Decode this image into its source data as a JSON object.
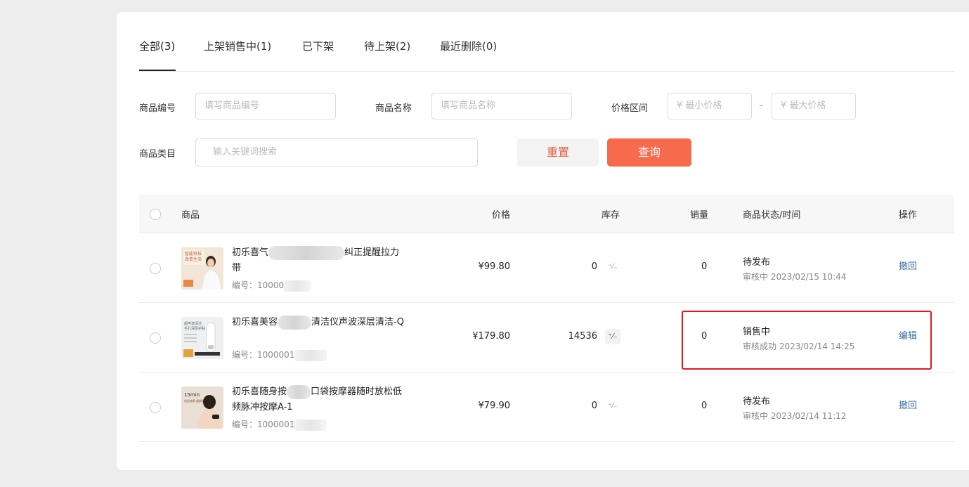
{
  "tabs": [
    {
      "label": "全部(3)"
    },
    {
      "label": "上架销售中(1)"
    },
    {
      "label": "已下架"
    },
    {
      "label": "待上架(2)"
    },
    {
      "label": "最近删除(0)"
    }
  ],
  "filters": {
    "code_label": "商品编号",
    "code_placeholder": "填写商品编号",
    "name_label": "商品名称",
    "name_placeholder": "填写商品名称",
    "price_label": "价格区间",
    "min_placeholder": "¥  最小价格",
    "max_placeholder": "¥  最大价格",
    "dash": "–",
    "category_label": "商品类目",
    "category_placeholder": "输入关键词搜索",
    "reset_label": "重置",
    "query_label": "查询"
  },
  "table": {
    "headers": {
      "product": "商品",
      "price": "价格",
      "stock": "库存",
      "sales": "销量",
      "status": "商品状态/时间",
      "action": "操作"
    },
    "stock_edit_icon": "⁺⁄₋",
    "rows": [
      {
        "name_a": "初乐喜气",
        "name_b": "纠正提醒拉力带",
        "code_prefix": "编号：10000",
        "price": "¥99.80",
        "stock": "0",
        "sales": "0",
        "status": "待发布",
        "status_sub": "审核中 2023/02/15 10:44",
        "action": "撤回"
      },
      {
        "name_a": "初乐喜美容",
        "name_b": "清洁仪声波深层清洁-Q",
        "code_prefix": "编号：1000001",
        "price": "¥179.80",
        "stock": "14536",
        "sales": "0",
        "status": "销售中",
        "status_sub": "审核成功 2023/02/14 14:25",
        "action": "编辑"
      },
      {
        "name_a": "初乐喜随身按",
        "name_b": "口袋按摩器随时放松低频脉冲按摩A-1",
        "code_prefix": "编号：1000001",
        "price": "¥79.90",
        "stock": "0",
        "sales": "0",
        "status": "待发布",
        "status_sub": "审核中 2023/02/14 11:12",
        "action": "撤回"
      }
    ]
  },
  "thumbnails": [
    {
      "line1": "智能科技",
      "line2": "改变生活"
    },
    {
      "line1": "超声波清洁",
      "line2": "毛孔深层护肤"
    },
    {
      "line1": "15min",
      "line2": "轻松按摩 缓解疲劳"
    }
  ],
  "colors": {
    "accent": "#f76a4c",
    "link": "#3b6ea5",
    "highlight_box": "#e0191f"
  }
}
